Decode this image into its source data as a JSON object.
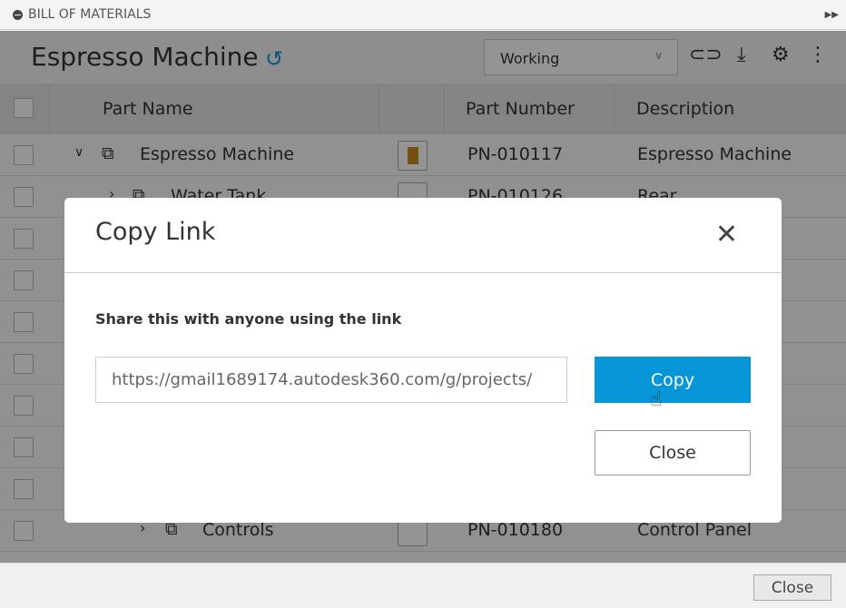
{
  "panel": {
    "title": "BILL OF MATERIALS"
  },
  "header": {
    "title": "Espresso Machine",
    "view_select": "Working"
  },
  "table": {
    "columns": [
      "Part Name",
      "Part Number",
      "Description"
    ],
    "rows": [
      {
        "name": "Espresso Machine",
        "number": "PN-010117",
        "description": "Espresso Machine",
        "expanded": true,
        "level": 0
      },
      {
        "name": "Water Tank",
        "number": "PN-010126",
        "description": "Rear",
        "expanded": false,
        "level": 1
      },
      {
        "name": "Controls",
        "number": "PN-010180",
        "description": "Control Panel",
        "expanded": false,
        "level": 2
      }
    ]
  },
  "modal": {
    "title": "Copy Link",
    "label": "Share this with anyone using the link",
    "link": "https://gmail1689174.autodesk360.com/g/projects/",
    "copy_label": "Copy",
    "close_label": "Close"
  },
  "footer": {
    "close_label": "Close"
  }
}
